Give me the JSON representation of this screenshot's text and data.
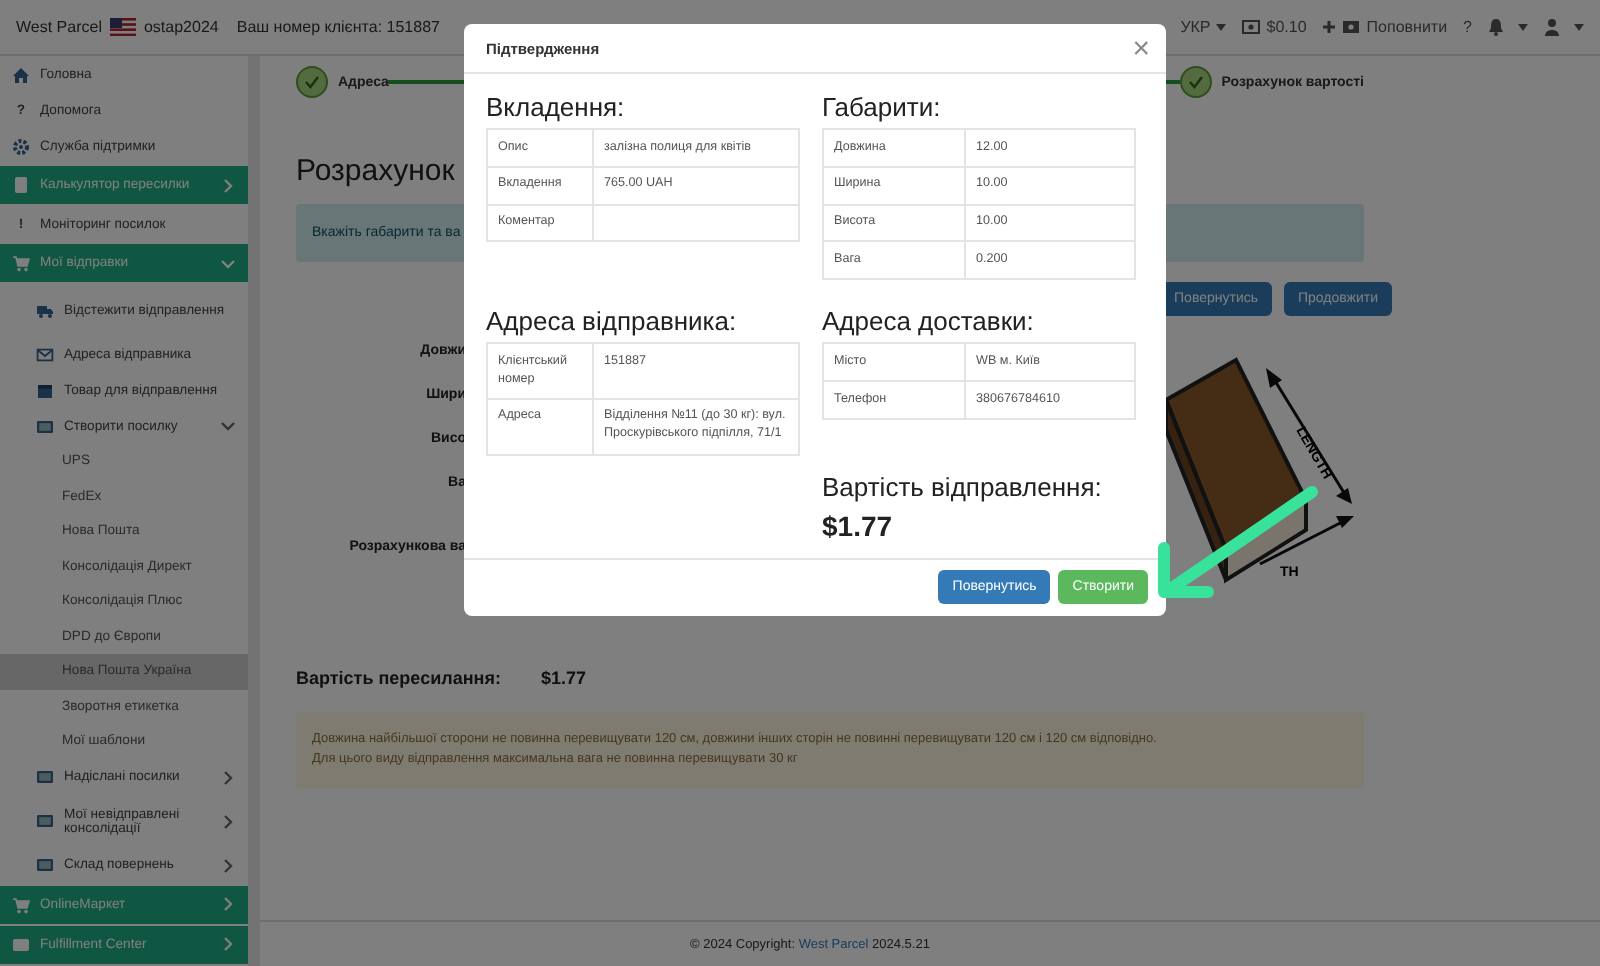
{
  "topbar": {
    "brand": "West Parcel",
    "username": "ostap2024",
    "client_number": "Ваш номер клієнта: 151887",
    "language": "УКР",
    "balance": "$0.10",
    "top_up": "Поповнити",
    "help": "?"
  },
  "sidebar": [
    {
      "label": "Головна",
      "kind": "link"
    },
    {
      "label": "Допомога",
      "kind": "link",
      "glyph": "?"
    },
    {
      "label": "Служба підтримки",
      "kind": "link"
    },
    {
      "label": "Калькулятор пересилки",
      "kind": "section",
      "expanded": false
    },
    {
      "label": "Моніторинг посилок",
      "kind": "link",
      "glyph": "!"
    },
    {
      "label": "Мої відправки",
      "kind": "section",
      "expanded": true,
      "children": [
        {
          "label": "Відстежити відправлення",
          "kind": "link"
        },
        {
          "label": "Адреса відправника",
          "kind": "link"
        },
        {
          "label": "Товар для відправлення",
          "kind": "link"
        },
        {
          "label": "Створити посилку",
          "kind": "group",
          "expanded": true,
          "children": [
            {
              "label": "UPS",
              "selected": false
            },
            {
              "label": "FedEx",
              "selected": false
            },
            {
              "label": "Нова Пошта",
              "selected": false
            },
            {
              "label": "Консолідація Директ",
              "selected": false
            },
            {
              "label": "Консолідація Плюс",
              "selected": false
            },
            {
              "label": "DPD до Європи",
              "selected": false
            },
            {
              "label": "Нова Пошта Україна",
              "selected": true
            },
            {
              "label": "Зворотня етикетка",
              "selected": false
            },
            {
              "label": "Мої шаблони",
              "selected": false
            }
          ]
        },
        {
          "label": "Надіслані посилки",
          "kind": "group",
          "expanded": false
        },
        {
          "label": "Мої невідправлені консолідації",
          "kind": "group",
          "expanded": false
        },
        {
          "label": "Склад повернень",
          "kind": "group",
          "expanded": false
        }
      ]
    },
    {
      "label": "OnlineМаркет",
      "kind": "section",
      "expanded": false
    },
    {
      "label": "Fulfillment Center",
      "kind": "section",
      "expanded": false
    }
  ],
  "steps": [
    {
      "label": "Адреса",
      "done": true
    },
    {
      "label": "Розрахунок вартості",
      "done": true
    }
  ],
  "main": {
    "title": "Розрахунок",
    "info": "Вкажіть габарити та ва",
    "buttons": [
      {
        "label": "Повернутись"
      },
      {
        "label": "Продовжити"
      }
    ],
    "form_labels": [
      "Довжи",
      "Шири",
      "Висо",
      "Ва",
      "Розрахункова ва"
    ],
    "drawing_labels": [
      "LENGTH",
      "TH"
    ],
    "cost_label": "Вартість пересилання:",
    "cost_value": "$1.77",
    "warning": [
      "Довжина найбільшої сторони не повинна перевищувати 120 см, довжини інших сторін не повинні перевищувати 120 см і 120 см відповідно.",
      "Для цього виду відправлення максимальна вага не повинна перевищувати 30 кг"
    ]
  },
  "footer": {
    "text": "© 2024 Copyright:",
    "link": "West Parcel",
    "version": "2024.5.21"
  },
  "modal": {
    "title": "Підтвердження",
    "close": "×",
    "sections": [
      {
        "heading": "Вкладення:",
        "rows": [
          {
            "label": "Опис",
            "value": "залізна полиця для квітів"
          },
          {
            "label": "Вкладення",
            "value": "765.00 UAH"
          },
          {
            "label": "Коментар"
          }
        ]
      },
      {
        "heading": "Габарити:",
        "rows": [
          {
            "label": "Довжина",
            "value": "12.00"
          },
          {
            "label": "Ширина",
            "value": "10.00"
          },
          {
            "label": "Висота",
            "value": "10.00"
          },
          {
            "label": "Вага",
            "value": "0.200"
          }
        ]
      },
      {
        "heading": "Адреса відправника:",
        "rows": [
          {
            "label": "Клієнтський номер",
            "value": "151887"
          },
          {
            "label": "Адреса",
            "value": "Відділення №11 (до 30 кг): вул. Проскурівського підпілля, 71/1"
          }
        ]
      },
      {
        "heading": "Адреса доставки:",
        "rows": [
          {
            "label": "Місто",
            "value": "WB м. Київ"
          },
          {
            "label": "Телефон",
            "value": "380676784610"
          }
        ]
      }
    ],
    "cost_label": "Вартість відправлення:",
    "cost_value": "$1.77",
    "buttons": [
      {
        "label": "Повернутись",
        "kind": "primary"
      },
      {
        "label": "Створити",
        "kind": "success"
      }
    ]
  }
}
